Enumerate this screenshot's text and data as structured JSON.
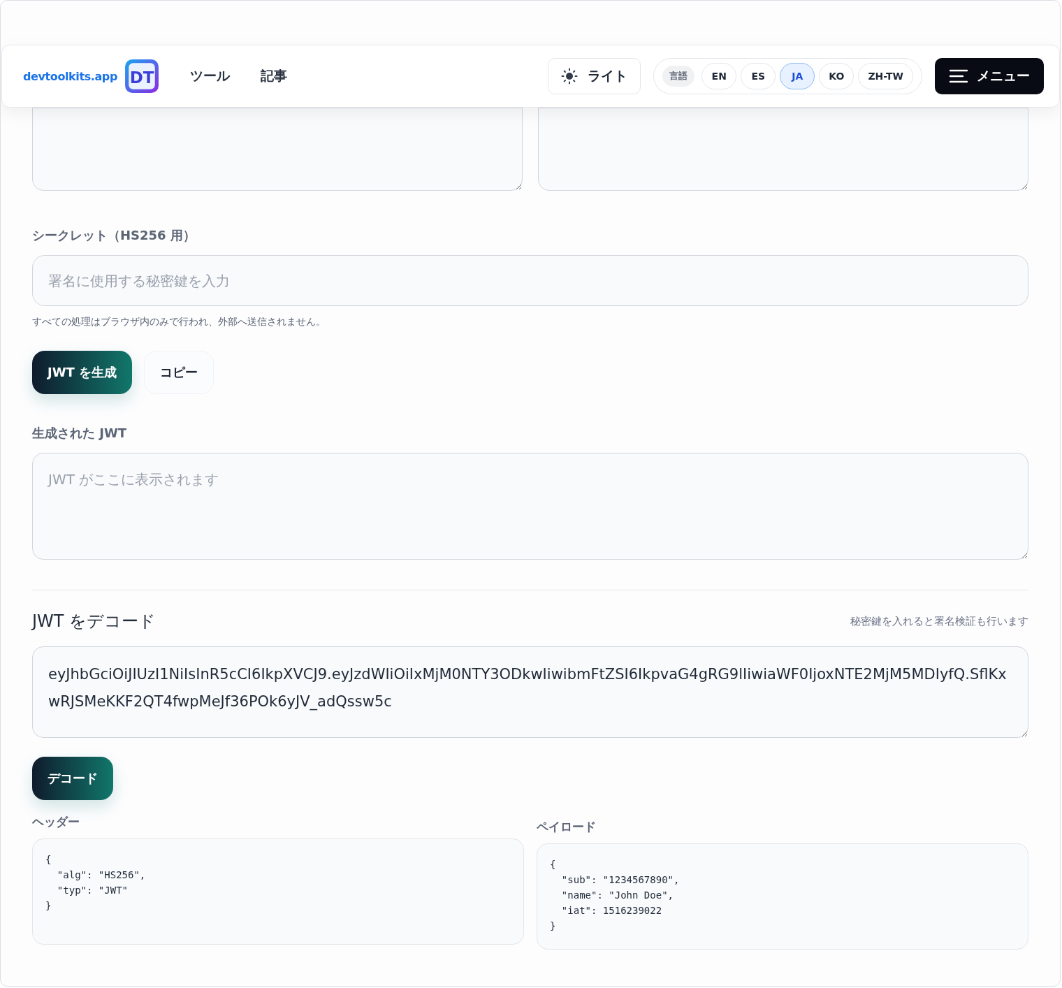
{
  "header": {
    "brand": "devtoolkits.app",
    "logo_mark": "DT",
    "nav": [
      {
        "label": "ツール"
      },
      {
        "label": "記事"
      }
    ],
    "theme": {
      "label": "ライト"
    },
    "languages": {
      "label": "言語",
      "options": [
        {
          "label": "EN",
          "selected": false
        },
        {
          "label": "ES",
          "selected": false
        },
        {
          "label": "JA",
          "selected": true
        },
        {
          "label": "KO",
          "selected": false
        },
        {
          "label": "ZH-TW",
          "selected": false
        }
      ]
    },
    "menu": {
      "label": "メニュー"
    }
  },
  "encode": {
    "secret": {
      "label": "シークレット（HS256 用）",
      "placeholder": "署名に使用する秘密鍵を入力"
    },
    "note": "すべての処理はブラウザ内のみで行われ、外部へ送信されません。",
    "buttons": [
      {
        "label": "JWT を生成",
        "kind": "primary"
      },
      {
        "label": "コピー",
        "kind": "secondary"
      }
    ],
    "output": {
      "label": "生成された JWT",
      "placeholder": "JWT がここに表示されます"
    }
  },
  "decode": {
    "title": "JWT をデコード",
    "hint": "秘密鍵を入れると署名検証も行います",
    "token": "eyJhbGciOiJIUzI1NiIsInR5cCI6IkpXVCJ9.eyJzdWIiOiIxMjM0NTY3ODkwIiwibmFtZSI6IkpvaG4gRG9lIiwiaWF0IjoxNTE2MjM5MDIyfQ.SflKxwRJSMeKKF2QT4fwpMeJf36POk6yJV_adQssw5c",
    "button": {
      "label": "デコード"
    },
    "results": [
      {
        "label": "ヘッダー",
        "content": "{\n  \"alg\": \"HS256\",\n  \"typ\": \"JWT\"\n}"
      },
      {
        "label": "ペイロード",
        "content": "{\n  \"sub\": \"1234567890\",\n  \"name\": \"John Doe\",\n  \"iat\": 1516239022\n}"
      }
    ]
  }
}
